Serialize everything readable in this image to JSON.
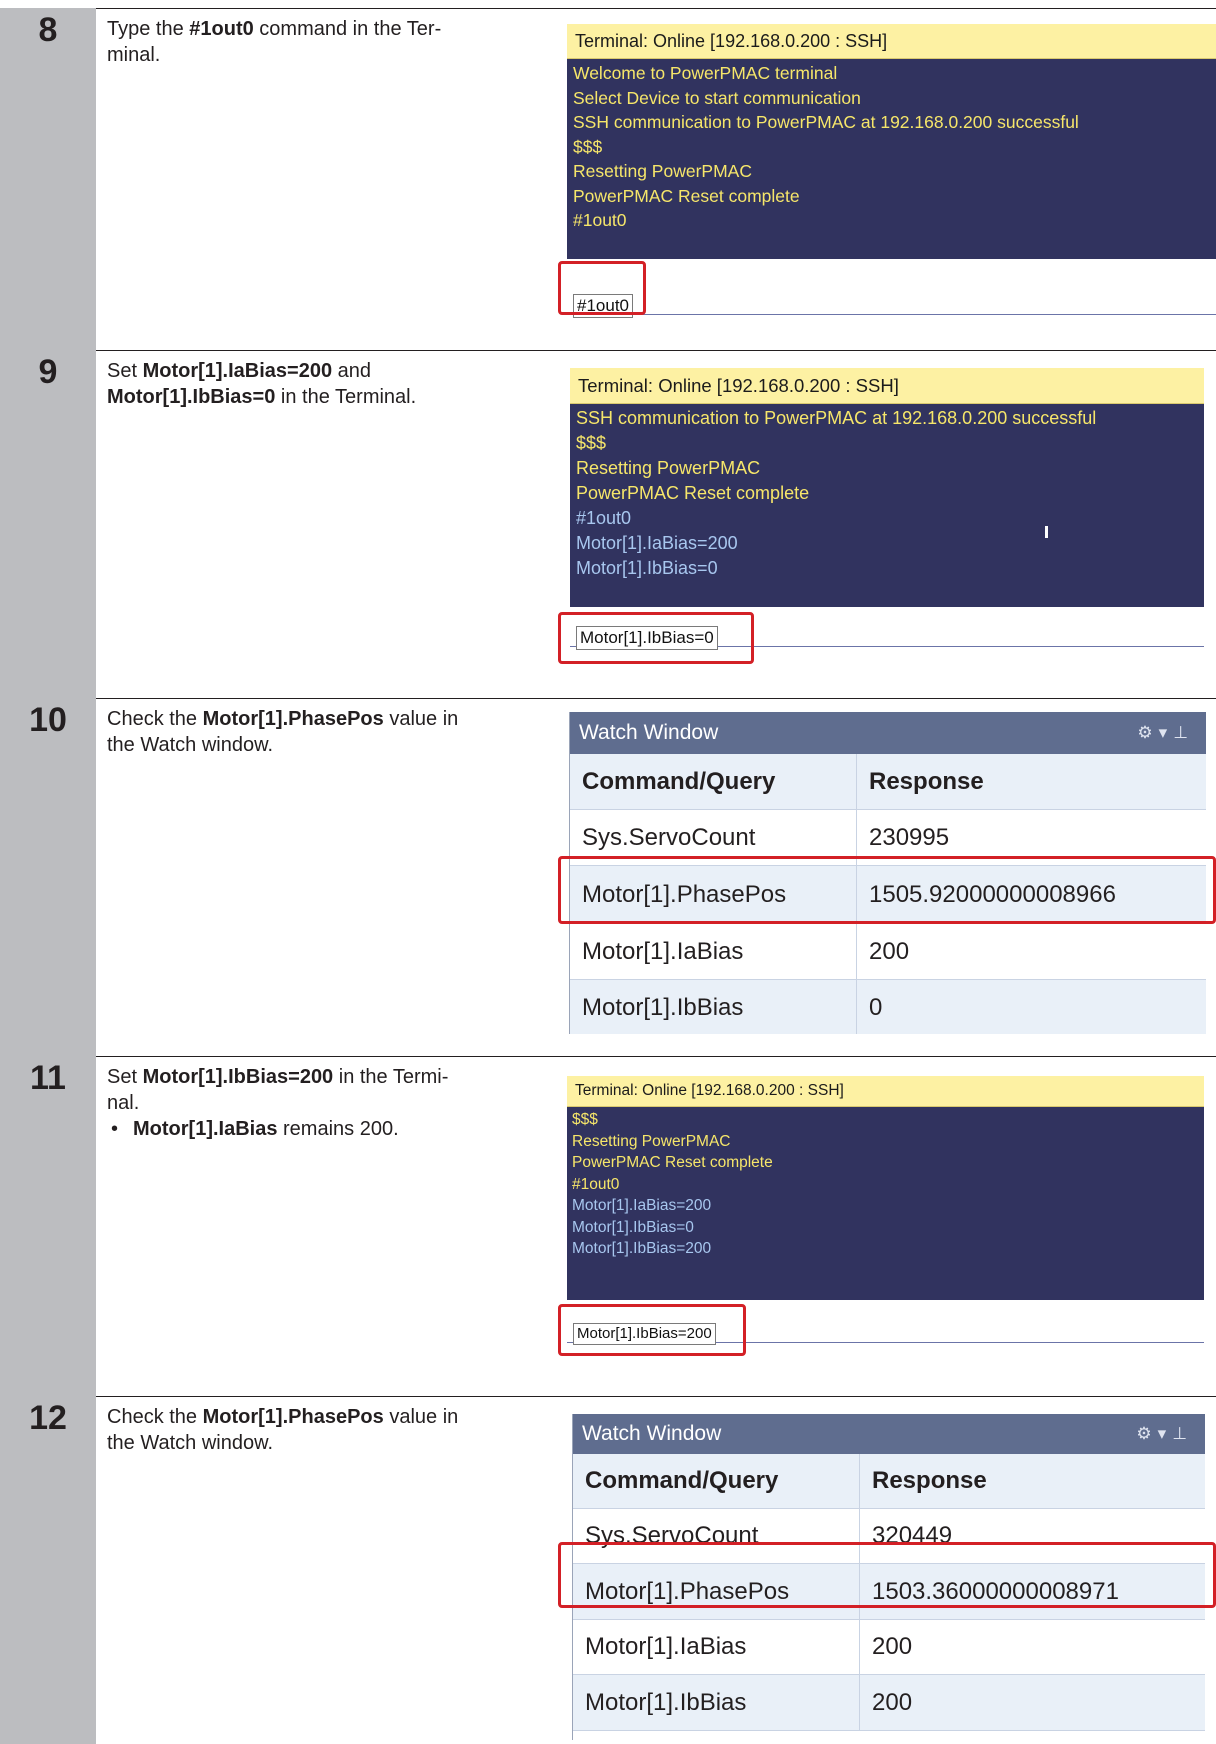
{
  "steps": [
    {
      "number": "8",
      "desc_pre": "Type the ",
      "desc_bold": "#1out0",
      "desc_post_1": " command in the Ter-",
      "desc_post_2": "minal.",
      "terminal": {
        "title": "Terminal: Online [192.168.0.200 : SSH]",
        "lines": [
          "Welcome to PowerPMAC terminal",
          "Select Device to start communication",
          "SSH communication to PowerPMAC at 192.168.0.200 successful",
          "$$$",
          "Resetting PowerPMAC",
          "PowerPMAC Reset complete",
          "#1out0"
        ],
        "input_value": "#1out0"
      }
    },
    {
      "number": "9",
      "desc_l1_pre": "Set ",
      "desc_l1_bold": "Motor[1].IaBias=200",
      "desc_l1_post": " and",
      "desc_l2_bold": "Motor[1].IbBias=0",
      "desc_l2_post": " in the Terminal.",
      "terminal": {
        "title": "Terminal: Online [192.168.0.200 : SSH]",
        "lines": [
          "SSH communication to PowerPMAC at 192.168.0.200 successful",
          "$$$",
          "Resetting PowerPMAC",
          "PowerPMAC Reset complete",
          "#1out0",
          "Motor[1].IaBias=200",
          "Motor[1].IbBias=0"
        ],
        "input_value": "Motor[1].IbBias=0"
      }
    },
    {
      "number": "10",
      "desc_l1_pre": "Check the ",
      "desc_l1_bold": "Motor[1].PhasePos",
      "desc_l1_post": " value in",
      "desc_l2": "the Watch window.",
      "watch": {
        "title": "Watch Window",
        "col1": "Command/Query",
        "col2": "Response",
        "rows": [
          {
            "cmd": "Sys.ServoCount",
            "resp": "230995"
          },
          {
            "cmd": "Motor[1].PhasePos",
            "resp": "1505.92000000008966"
          },
          {
            "cmd": "Motor[1].IaBias",
            "resp": "200"
          },
          {
            "cmd": "Motor[1].IbBias",
            "resp": "0"
          }
        ]
      }
    },
    {
      "number": "11",
      "desc_l1_pre": "Set ",
      "desc_l1_bold": "Motor[1].IbBias=200",
      "desc_l1_post": " in the Termi-",
      "desc_l2": "nal.",
      "bullet_bold": "Motor[1].IaBias",
      "bullet_post": " remains 200.",
      "terminal": {
        "title": "Terminal: Online [192.168.0.200 : SSH]",
        "lines": [
          "$$$",
          "Resetting PowerPMAC",
          "PowerPMAC Reset complete",
          "#1out0",
          "Motor[1].IaBias=200",
          "Motor[1].IbBias=0",
          "Motor[1].IbBias=200"
        ],
        "input_value": "Motor[1].IbBias=200"
      }
    },
    {
      "number": "12",
      "desc_l1_pre": "Check the ",
      "desc_l1_bold": "Motor[1].PhasePos",
      "desc_l1_post": " value in",
      "desc_l2": "the Watch window.",
      "watch": {
        "title": "Watch Window",
        "col1": "Command/Query",
        "col2": "Response",
        "rows": [
          {
            "cmd": "Sys.ServoCount",
            "resp": "320449"
          },
          {
            "cmd": "Motor[1].PhasePos",
            "resp": "1503.36000000008971"
          },
          {
            "cmd": "Motor[1].IaBias",
            "resp": "200"
          },
          {
            "cmd": "Motor[1].IbBias",
            "resp": "200"
          }
        ]
      }
    }
  ],
  "colors": {
    "accent_red": "#d32026",
    "terminal_bg": "#31335f",
    "terminal_title_bg": "#fdf1a3",
    "terminal_yellow": "#f6e66a",
    "terminal_blue": "#a8c7ef",
    "watch_title_bg": "#5f6d8f",
    "number_column": "#bcbdc0"
  },
  "icons": [
    "settings-gear-icon",
    "dropdown-arrow-icon",
    "pin-icon"
  ]
}
